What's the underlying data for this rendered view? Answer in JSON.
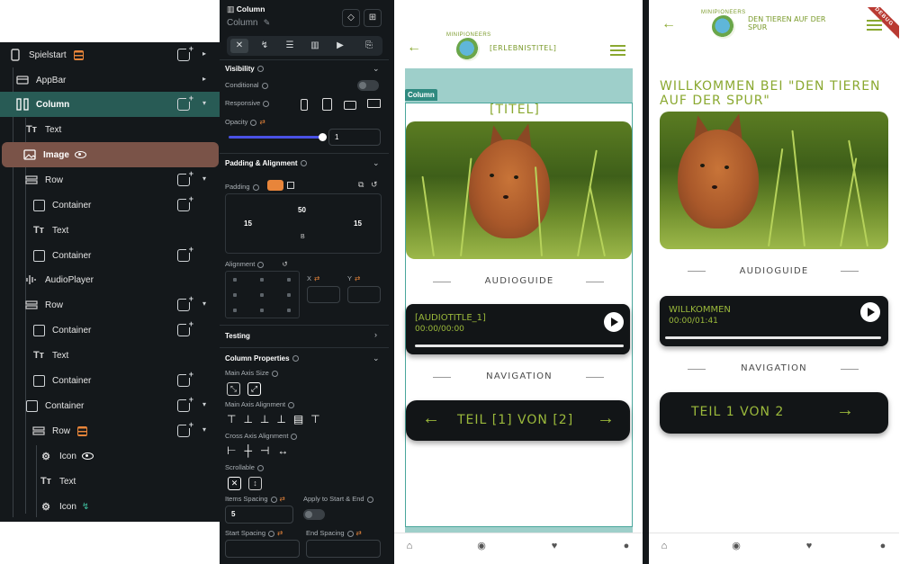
{
  "tree": {
    "items": [
      {
        "label": "Spielstart",
        "icon": "phone-icon"
      },
      {
        "label": "AppBar",
        "icon": "appbar-icon"
      },
      {
        "label": "Column",
        "icon": "column-icon"
      },
      {
        "label": "Text",
        "icon": "text-icon"
      },
      {
        "label": "Image",
        "icon": "image-icon"
      },
      {
        "label": "Row",
        "icon": "row-icon"
      },
      {
        "label": "Container",
        "icon": "container-icon"
      },
      {
        "label": "Text",
        "icon": "text-icon"
      },
      {
        "label": "Container",
        "icon": "container-icon"
      },
      {
        "label": "AudioPlayer",
        "icon": "audio-icon"
      },
      {
        "label": "Row",
        "icon": "row-icon"
      },
      {
        "label": "Container",
        "icon": "container-icon"
      },
      {
        "label": "Text",
        "icon": "text-icon"
      },
      {
        "label": "Container",
        "icon": "container-icon"
      },
      {
        "label": "Container",
        "icon": "container-icon"
      },
      {
        "label": "Row",
        "icon": "row-icon"
      },
      {
        "label": "Icon",
        "icon": "gear-icon"
      },
      {
        "label": "Text",
        "icon": "text-icon"
      },
      {
        "label": "Icon",
        "icon": "gear-icon"
      }
    ]
  },
  "props": {
    "widget_name": "Column",
    "widget_sub": "Column",
    "visibility": {
      "heading": "Visibility",
      "conditional": "Conditional",
      "responsive": "Responsive",
      "opacity": "Opacity",
      "opacity_value": "1",
      "opacity_level": 1
    },
    "padding": {
      "heading": "Padding & Alignment",
      "label": "Padding",
      "top": "50",
      "left": "15",
      "right": "15",
      "bottom": "B",
      "alignment": "Alignment",
      "x_label": "X",
      "y_label": "Y"
    },
    "testing": "Testing",
    "column_props": {
      "heading": "Column Properties",
      "main_axis_size": "Main Axis Size",
      "main_axis_alignment": "Main Axis Alignment",
      "cross_axis_alignment": "Cross Axis Alignment",
      "scrollable": "Scrollable",
      "items_spacing": "Items Spacing",
      "items_spacing_value": "5",
      "apply_start_end": "Apply to Start & End",
      "start_spacing": "Start Spacing",
      "end_spacing": "End Spacing"
    }
  },
  "phone1": {
    "appbar_title": "[ERLEBNISTITEL]",
    "logo_text": "MINIPIONEERS",
    "column_tag": "Column",
    "title": "[TITEL]",
    "audioguide": "AUDIOGUIDE",
    "audio_title": "[AUDIOTITLE_1]",
    "audio_time": "00:00/00:00",
    "navigation": "NAVIGATION",
    "nav_text": "TEIL [1] VON [2]"
  },
  "phone2": {
    "appbar_title": "DEN TIEREN AUF DER SPUR",
    "logo_text": "MINIPIONEERS",
    "debug": "DEBUG",
    "welcome": "WILLKOMMEN BEI \"DEN TIEREN AUF DER SPUR\"",
    "audioguide": "AUDIOGUIDE",
    "audio_title": "WILLKOMMEN",
    "audio_time": "00:00/01:41",
    "navigation": "NAVIGATION",
    "nav_text": "TEIL 1 VON 2"
  },
  "colors": {
    "accent_green": "#9bb93b",
    "teal_selection": "#285b55",
    "image_highlight": "#7a5348",
    "slider_blue": "#4a52e5"
  }
}
